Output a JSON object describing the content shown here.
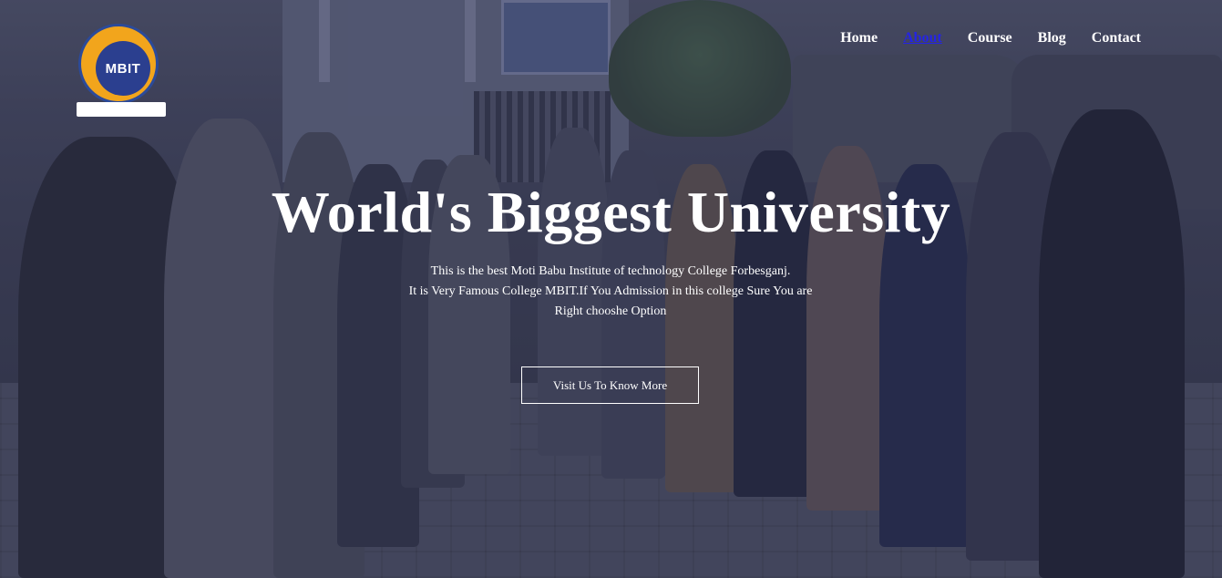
{
  "logo": {
    "text": "MBIT"
  },
  "nav": {
    "items": [
      {
        "label": "Home"
      },
      {
        "label": "About"
      },
      {
        "label": "Course"
      },
      {
        "label": "Blog"
      },
      {
        "label": "Contact"
      }
    ],
    "active_color": "#2424e6"
  },
  "hero": {
    "title": "World's Biggest University",
    "description_line1": "This is the best Moti Babu Institute of technology College Forbesganj.",
    "description_line2": "It is Very Famous College MBIT.If You Admission in this college Sure You are",
    "description_line3": "Right chooshe Option",
    "button_label": "Visit Us To Know More"
  }
}
